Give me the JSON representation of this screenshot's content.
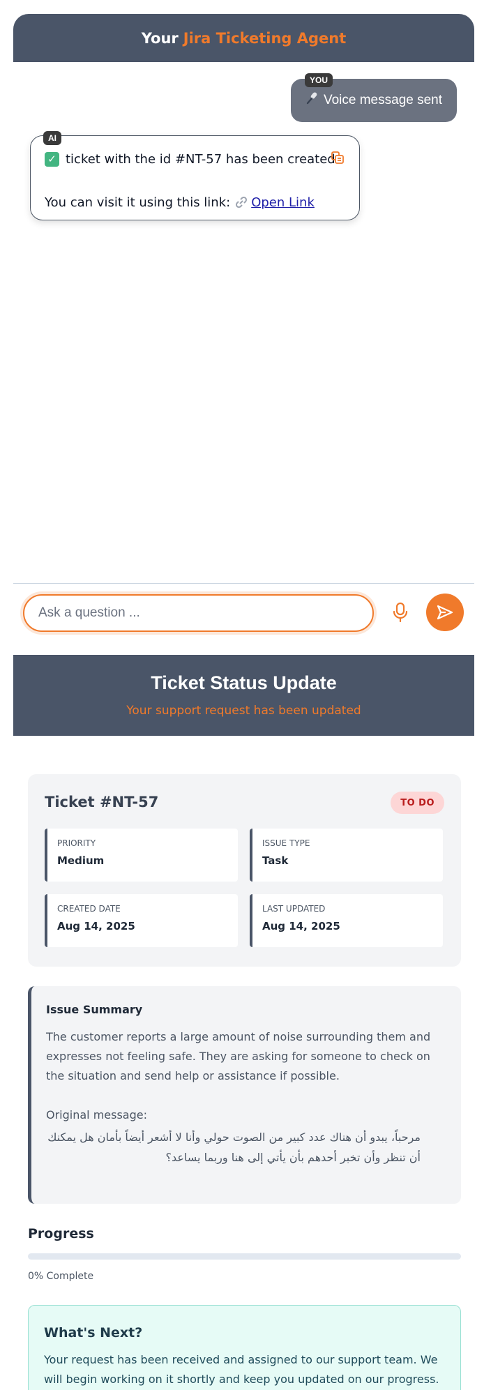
{
  "chat": {
    "header": {
      "prefix": "Your",
      "accent": "Jira Ticketing Agent"
    },
    "user_message": {
      "sender_badge": "YOU",
      "icon": "microphone-icon",
      "text": "Voice message sent"
    },
    "ai_message": {
      "sender_badge": "AI",
      "line1": "ticket with the id #NT-57 has been created.",
      "line2_prefix": "You can visit it using this link:",
      "link_label": "Open Link"
    },
    "input": {
      "placeholder": "Ask a question ...",
      "value": ""
    }
  },
  "ticket": {
    "header": {
      "title": "Ticket Status Update",
      "subtitle": "Your support request has been updated"
    },
    "id_title": "Ticket #NT-57",
    "status": "TO DO",
    "fields": {
      "priority": {
        "label": "PRIORITY",
        "value": "Medium"
      },
      "issue_type": {
        "label": "ISSUE TYPE",
        "value": "Task"
      },
      "created_date": {
        "label": "CREATED DATE",
        "value": "Aug 14, 2025"
      },
      "last_updated": {
        "label": "LAST UPDATED",
        "value": "Aug 14, 2025"
      }
    },
    "summary": {
      "title": "Issue Summary",
      "text": "The customer reports a large amount of noise surrounding them and expresses not feeling safe. They are asking for someone to check on the situation and send help or assistance if possible.\n\nOriginal message:",
      "original_message": "مرحباً، يبدو أن هناك عدد كبير من الصوت حولي وأنا لا أشعر أيضاً بأمان هل يمكنك أن تنظر وأن تخبر أحدهم بأن يأتي إلى هنا وربما يساعد؟"
    },
    "progress": {
      "title": "Progress",
      "percent": 0,
      "label": "0% Complete"
    },
    "next": {
      "title": "What's Next?",
      "text": "Your request has been received and assigned to our support team. We will begin working on it shortly and keep you updated on our progress."
    }
  },
  "colors": {
    "accent": "#f07a2b",
    "header_bg": "#4a5568",
    "status_bg": "#fdd6d6",
    "status_text": "#b91c1c"
  }
}
